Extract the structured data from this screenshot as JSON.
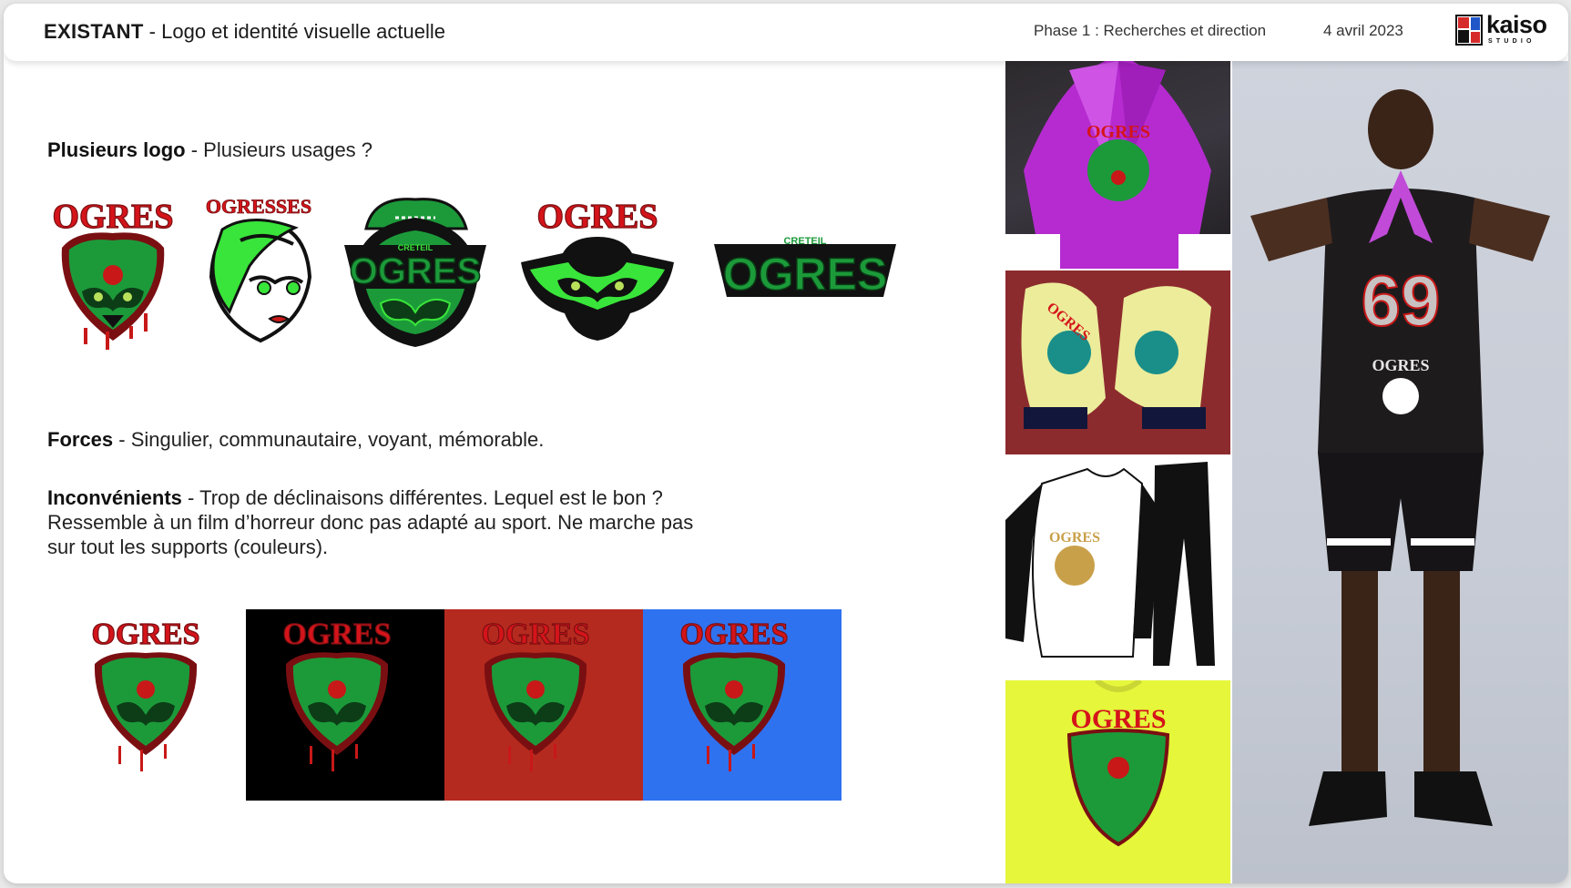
{
  "header": {
    "title_bold": "EXISTANT",
    "title_rest": " - Logo et identité visuelle actuelle",
    "phase": "Phase 1 : Recherches et direction",
    "date": "4 avril 2023",
    "brand": "kaiso",
    "brand_sub": "STUDIO"
  },
  "section_logos": {
    "label_bold": "Plusieurs logo",
    "label_rest": " - Plusieurs usages ?"
  },
  "logos": [
    {
      "name": "ogres-red-logo",
      "text": "OGRES"
    },
    {
      "name": "ogresses-logo",
      "text": "OGRESSES"
    },
    {
      "name": "creteil-ogres-badge",
      "text": "OGRES",
      "small": "CRETEIL"
    },
    {
      "name": "ogres-wings-logo",
      "text": "OGRES"
    },
    {
      "name": "creteil-ogres-wordmark",
      "text": "OGRES",
      "small": "CRETEIL"
    }
  ],
  "forces": {
    "label_bold": "Forces",
    "label_rest": " - Singulier, communautaire, voyant, mémorable."
  },
  "inconvenients": {
    "label_bold": "Inconvénients",
    "label_rest": " - Trop de déclinaisons différentes. Lequel est le bon ? Ressemble à un film d’horreur donc pas adapté au sport. Ne marche pas sur tout les supports (couleurs)."
  },
  "backgrounds": {
    "text": "OGRES",
    "colors": [
      "#ffffff",
      "#000000",
      "#b52a1f",
      "#2f72f0"
    ]
  },
  "photos": [
    {
      "name": "purple-gloves-photo",
      "caption": "OGRES"
    },
    {
      "name": "yellow-gloves-photo",
      "caption": "OGRES"
    },
    {
      "name": "tracksuit-photo",
      "caption": "OGRES"
    },
    {
      "name": "yellow-tshirt-photo",
      "caption": "OGRES"
    },
    {
      "name": "player-photo",
      "jersey_number": "69",
      "caption": "OGRES"
    }
  ],
  "colors": {
    "ogre_green": "#1c9a3a",
    "neon_green": "#39e53a",
    "blood_red": "#d4141a",
    "dark": "#111111"
  }
}
